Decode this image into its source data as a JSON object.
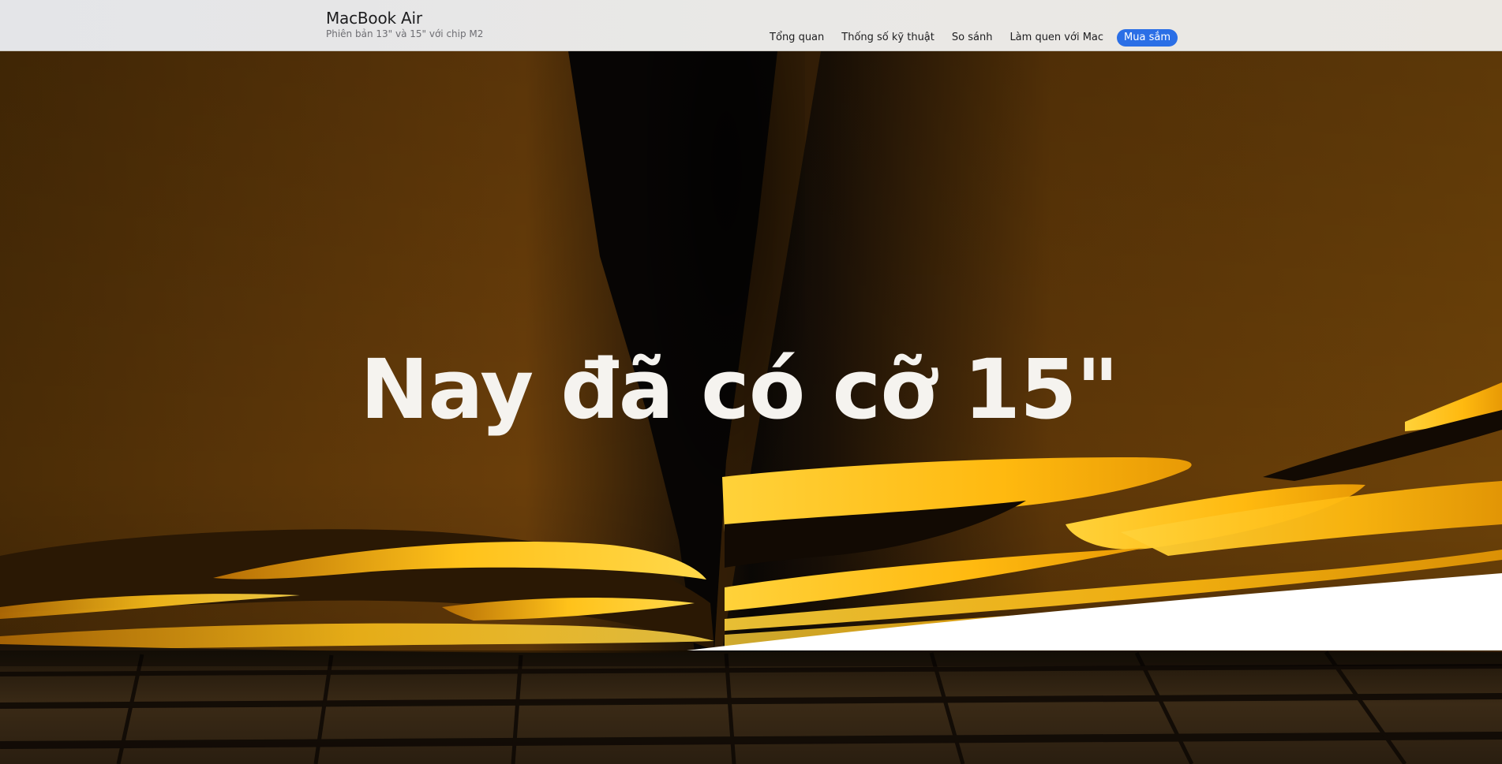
{
  "localnav": {
    "product_title": "MacBook Air",
    "product_subtitle": "Phiên bản 13\" và 15\" với chip M2",
    "links": [
      {
        "label": "Tổng quan"
      },
      {
        "label": "Thống số kỹ thuật"
      },
      {
        "label": "So sánh"
      },
      {
        "label": "Làm quen với Mac"
      }
    ],
    "buy_label": "Mua sắm",
    "buy_color": "#2b6fe6"
  },
  "hero": {
    "headline": "Nay đã có cỡ 15\"",
    "palette": {
      "bronze": "#6b3f08",
      "dark": "#0a0805",
      "glow": "#ffc21a",
      "white": "#ffffff"
    }
  }
}
